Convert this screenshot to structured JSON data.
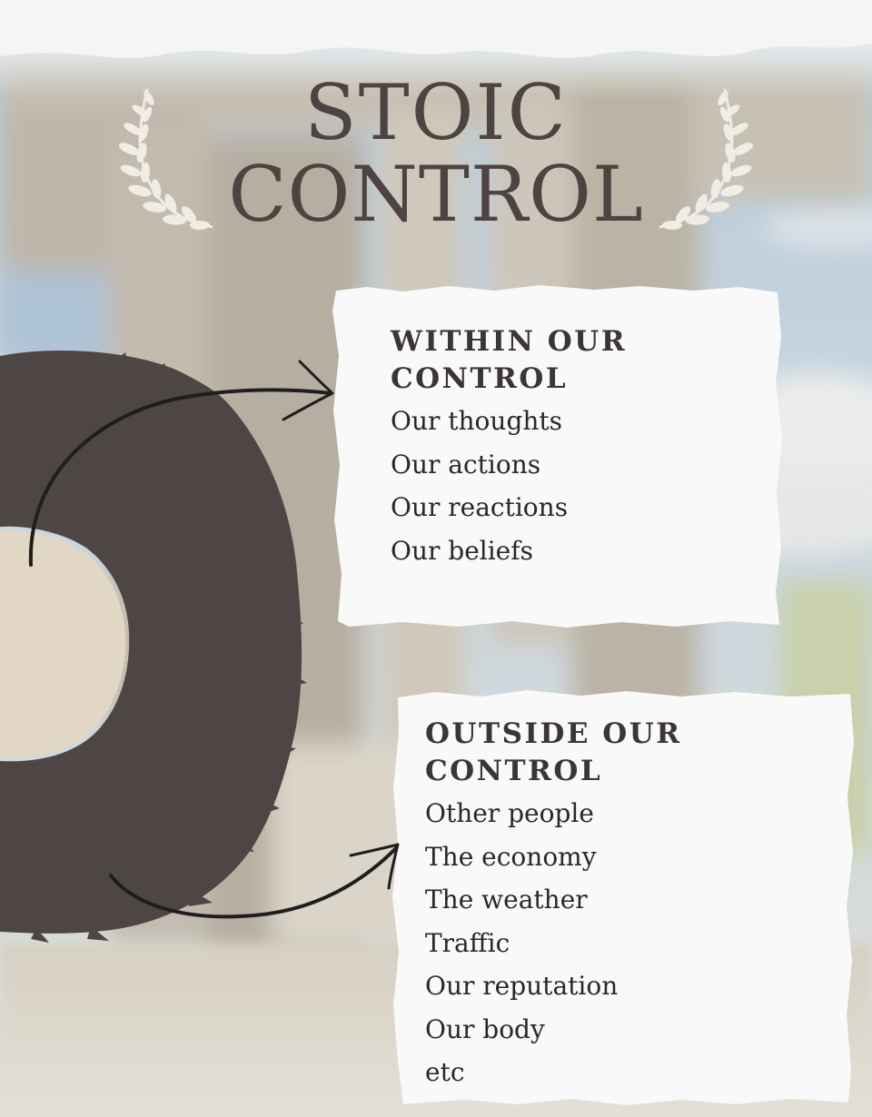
{
  "title": {
    "line1": "STOIC",
    "line2": "CONTROL"
  },
  "within": {
    "heading_line1": "WITHIN OUR",
    "heading_line2": "CONTROL",
    "items": [
      "Our thoughts",
      "Our actions",
      "Our reactions",
      "Our beliefs"
    ]
  },
  "outside": {
    "heading_line1": "OUTSIDE OUR",
    "heading_line2": "CONTROL",
    "items": [
      "Other people",
      "The economy",
      "The weather",
      "Traffic",
      "Our reputation",
      "Our body",
      "etc"
    ]
  },
  "colors": {
    "title": "#4d4441",
    "ring": "#4e4644",
    "ring_center": "#e2d6c4",
    "card": "#f9f9f9",
    "heading": "#3c3535",
    "text": "#2a2727",
    "arrow": "#1e1e1e",
    "laurel": "#f1ece4"
  },
  "icons": [
    "laurel-branch-icon",
    "arrow-icon"
  ]
}
